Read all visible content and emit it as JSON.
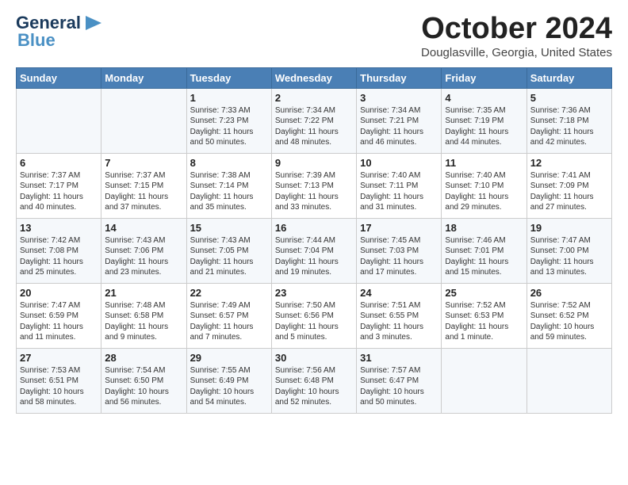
{
  "logo": {
    "line1": "General",
    "line2": "Blue",
    "icon": "▶"
  },
  "title": "October 2024",
  "location": "Douglasville, Georgia, United States",
  "days_of_week": [
    "Sunday",
    "Monday",
    "Tuesday",
    "Wednesday",
    "Thursday",
    "Friday",
    "Saturday"
  ],
  "weeks": [
    [
      {
        "day": "",
        "info": ""
      },
      {
        "day": "",
        "info": ""
      },
      {
        "day": "1",
        "info": "Sunrise: 7:33 AM\nSunset: 7:23 PM\nDaylight: 11 hours\nand 50 minutes."
      },
      {
        "day": "2",
        "info": "Sunrise: 7:34 AM\nSunset: 7:22 PM\nDaylight: 11 hours\nand 48 minutes."
      },
      {
        "day": "3",
        "info": "Sunrise: 7:34 AM\nSunset: 7:21 PM\nDaylight: 11 hours\nand 46 minutes."
      },
      {
        "day": "4",
        "info": "Sunrise: 7:35 AM\nSunset: 7:19 PM\nDaylight: 11 hours\nand 44 minutes."
      },
      {
        "day": "5",
        "info": "Sunrise: 7:36 AM\nSunset: 7:18 PM\nDaylight: 11 hours\nand 42 minutes."
      }
    ],
    [
      {
        "day": "6",
        "info": "Sunrise: 7:37 AM\nSunset: 7:17 PM\nDaylight: 11 hours\nand 40 minutes."
      },
      {
        "day": "7",
        "info": "Sunrise: 7:37 AM\nSunset: 7:15 PM\nDaylight: 11 hours\nand 37 minutes."
      },
      {
        "day": "8",
        "info": "Sunrise: 7:38 AM\nSunset: 7:14 PM\nDaylight: 11 hours\nand 35 minutes."
      },
      {
        "day": "9",
        "info": "Sunrise: 7:39 AM\nSunset: 7:13 PM\nDaylight: 11 hours\nand 33 minutes."
      },
      {
        "day": "10",
        "info": "Sunrise: 7:40 AM\nSunset: 7:11 PM\nDaylight: 11 hours\nand 31 minutes."
      },
      {
        "day": "11",
        "info": "Sunrise: 7:40 AM\nSunset: 7:10 PM\nDaylight: 11 hours\nand 29 minutes."
      },
      {
        "day": "12",
        "info": "Sunrise: 7:41 AM\nSunset: 7:09 PM\nDaylight: 11 hours\nand 27 minutes."
      }
    ],
    [
      {
        "day": "13",
        "info": "Sunrise: 7:42 AM\nSunset: 7:08 PM\nDaylight: 11 hours\nand 25 minutes."
      },
      {
        "day": "14",
        "info": "Sunrise: 7:43 AM\nSunset: 7:06 PM\nDaylight: 11 hours\nand 23 minutes."
      },
      {
        "day": "15",
        "info": "Sunrise: 7:43 AM\nSunset: 7:05 PM\nDaylight: 11 hours\nand 21 minutes."
      },
      {
        "day": "16",
        "info": "Sunrise: 7:44 AM\nSunset: 7:04 PM\nDaylight: 11 hours\nand 19 minutes."
      },
      {
        "day": "17",
        "info": "Sunrise: 7:45 AM\nSunset: 7:03 PM\nDaylight: 11 hours\nand 17 minutes."
      },
      {
        "day": "18",
        "info": "Sunrise: 7:46 AM\nSunset: 7:01 PM\nDaylight: 11 hours\nand 15 minutes."
      },
      {
        "day": "19",
        "info": "Sunrise: 7:47 AM\nSunset: 7:00 PM\nDaylight: 11 hours\nand 13 minutes."
      }
    ],
    [
      {
        "day": "20",
        "info": "Sunrise: 7:47 AM\nSunset: 6:59 PM\nDaylight: 11 hours\nand 11 minutes."
      },
      {
        "day": "21",
        "info": "Sunrise: 7:48 AM\nSunset: 6:58 PM\nDaylight: 11 hours\nand 9 minutes."
      },
      {
        "day": "22",
        "info": "Sunrise: 7:49 AM\nSunset: 6:57 PM\nDaylight: 11 hours\nand 7 minutes."
      },
      {
        "day": "23",
        "info": "Sunrise: 7:50 AM\nSunset: 6:56 PM\nDaylight: 11 hours\nand 5 minutes."
      },
      {
        "day": "24",
        "info": "Sunrise: 7:51 AM\nSunset: 6:55 PM\nDaylight: 11 hours\nand 3 minutes."
      },
      {
        "day": "25",
        "info": "Sunrise: 7:52 AM\nSunset: 6:53 PM\nDaylight: 11 hours\nand 1 minute."
      },
      {
        "day": "26",
        "info": "Sunrise: 7:52 AM\nSunset: 6:52 PM\nDaylight: 10 hours\nand 59 minutes."
      }
    ],
    [
      {
        "day": "27",
        "info": "Sunrise: 7:53 AM\nSunset: 6:51 PM\nDaylight: 10 hours\nand 58 minutes."
      },
      {
        "day": "28",
        "info": "Sunrise: 7:54 AM\nSunset: 6:50 PM\nDaylight: 10 hours\nand 56 minutes."
      },
      {
        "day": "29",
        "info": "Sunrise: 7:55 AM\nSunset: 6:49 PM\nDaylight: 10 hours\nand 54 minutes."
      },
      {
        "day": "30",
        "info": "Sunrise: 7:56 AM\nSunset: 6:48 PM\nDaylight: 10 hours\nand 52 minutes."
      },
      {
        "day": "31",
        "info": "Sunrise: 7:57 AM\nSunset: 6:47 PM\nDaylight: 10 hours\nand 50 minutes."
      },
      {
        "day": "",
        "info": ""
      },
      {
        "day": "",
        "info": ""
      }
    ]
  ]
}
